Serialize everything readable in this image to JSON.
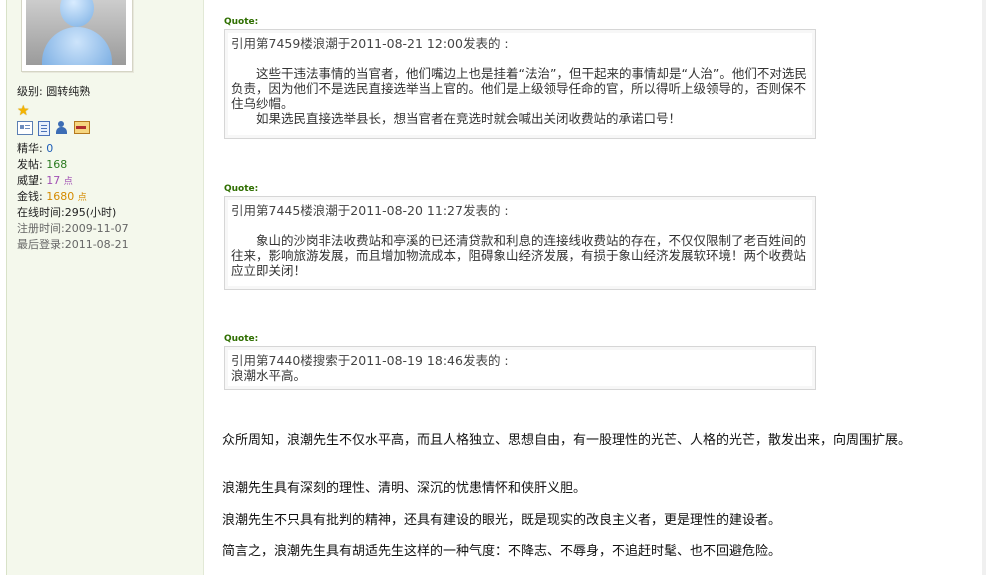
{
  "sidebar": {
    "level_label": "级别: ",
    "level_value": "圆转纯熟",
    "stats": [
      {
        "label": "精华: ",
        "value": "0"
      },
      {
        "label": "发帖: ",
        "value": "168"
      },
      {
        "label": "威望: ",
        "value": "17",
        "unit": "点"
      },
      {
        "label": "金钱: ",
        "value": "1680",
        "unit": "点"
      }
    ],
    "online_time": "在线时间:295(小时)",
    "register_time": "注册时间:2009-11-07",
    "last_login": "最后登录:2011-08-21",
    "icons": [
      "profile-card-icon",
      "posts-doc-icon",
      "add-friend-icon",
      "message-mail-icon"
    ]
  },
  "quotes": [
    {
      "label": "Quote:",
      "header": "引用第7459楼浪潮于2011-08-21 12:00发表的  :",
      "lines": [
        "这些干违法事情的当官者，他们嘴边上也是挂着“法治”，但干起来的事情却是“人治”。他们不对选民负责，因为他们不是选民直接选举当上官的。他们是上级领导任命的官，所以得听上级领导的，否则保不住乌纱帽。",
        "如果选民直接选举县长，想当官者在竞选时就会喊出关闭收费站的承诺口号！"
      ]
    },
    {
      "label": "Quote:",
      "header": "引用第7445楼浪潮于2011-08-20 11:27发表的  :",
      "lines": [
        "象山的沙岗非法收费站和亭溪的已还清贷款和利息的连接线收费站的存在，不仅仅限制了老百姓间的往来，影响旅游发展，而且增加物流成本，阻碍象山经济发展，有损于象山经济发展软环境！两个收费站应立即关闭！"
      ]
    },
    {
      "label": "Quote:",
      "header": "引用第7440楼搜索于2011-08-19 18:46发表的  :",
      "lines": [
        "浪潮水平高。"
      ]
    }
  ],
  "post": {
    "paragraphs": [
      "众所周知，浪潮先生不仅水平高，而且人格独立、思想自由，有一股理性的光芒、人格的光芒，散发出来，向周围扩展。",
      "浪潮先生具有深刻的理性、清明、深沉的忧患情怀和侠肝义胆。",
      "浪潮先生不只具有批判的精神，还具有建设的眼光，既是现实的改良主义者，更是理性的建设者。",
      "简言之，浪潮先生具有胡适先生这样的一种气度：不降志、不辱身，不追赶时髦、也不回避危险。"
    ]
  }
}
